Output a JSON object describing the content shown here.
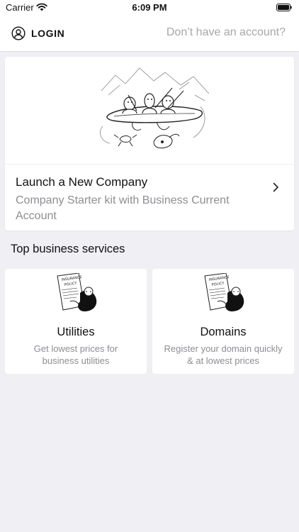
{
  "status_bar": {
    "carrier": "Carrier",
    "time": "6:09 PM",
    "icons": [
      "wifi-icon",
      "battery-icon"
    ]
  },
  "nav": {
    "login_label": "LOGIN",
    "login_icon": "user-circle-icon",
    "signup_link": "Don’t have an account?"
  },
  "hero": {
    "title": "Launch a New Company",
    "subtitle": "Company Starter kit with Business Current Account",
    "illustration": "people-in-canoe-illustration",
    "action_icon": "chevron-right-icon"
  },
  "section": {
    "title": "Top business services"
  },
  "services": [
    {
      "title": "Utilities",
      "description": "Get lowest prices for business utilities",
      "illustration": "insurance-policy-illustration",
      "art_text": [
        "INSURANCE",
        "POLICY"
      ]
    },
    {
      "title": "Domains",
      "description": "Register your domain quickly & at lowest prices",
      "illustration": "insurance-policy-illustration",
      "art_text": [
        "INSURANCE",
        "POLICY"
      ]
    }
  ],
  "colors": {
    "background": "#efeff4",
    "card": "#ffffff",
    "primary_text": "#111111",
    "secondary_text": "#8e8e93",
    "link_text": "#a7a7ac"
  }
}
